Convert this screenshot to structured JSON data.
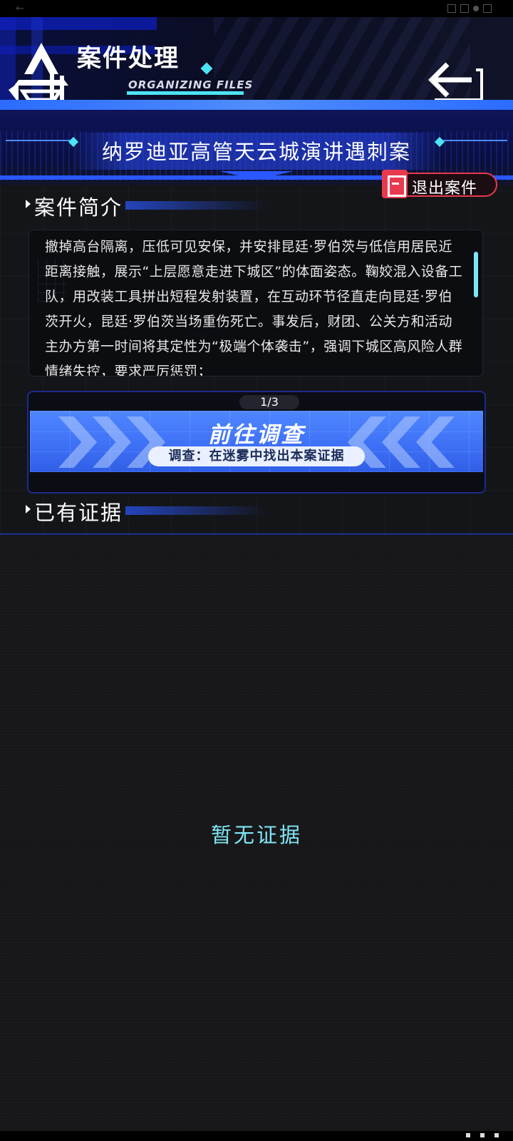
{
  "status": {
    "back_glyph": "←"
  },
  "header": {
    "title": "案件处理",
    "subtitle": "ORGANIZING FILES",
    "back_icon": "return-arrow-icon"
  },
  "case": {
    "title": "纳罗迪亚高管天云城演讲遇刺案"
  },
  "exit_button": {
    "label": "退出案件",
    "icon": "document-exit-icon",
    "color": "#e83a4f"
  },
  "summary_section": {
    "heading": "案件简介",
    "text": "撤掉高台隔离，压低可见安保，并安排昆廷·罗伯茨与低信用居民近距离接触，展示“上层愿意走进下城区”的体面姿态。鞠姣混入设备工队，用改装工具拼出短程发射装置，在互动环节径直走向昆廷·罗伯茨开火，昆廷·罗伯茨当场重伤死亡。事发后，财团、公关方和活动主办方第一时间将其定性为“极端个体袭击”，强调下城区高风险人群情绪失控，要求严厉惩罚；"
  },
  "investigation": {
    "pager": "1/3",
    "title": "前往调查",
    "subtitle": "调查：在迷雾中找出本案证据"
  },
  "evidence_section": {
    "heading": "已有证据",
    "empty_text": "暂无证据"
  },
  "colors": {
    "accent_cyan": "#7fe6f4",
    "accent_blue": "#3d6ff5",
    "danger_red": "#e83a4f"
  }
}
